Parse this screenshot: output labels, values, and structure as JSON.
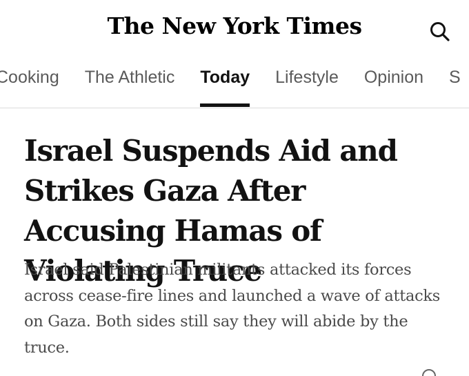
{
  "masthead": {
    "logo_text": "The New York Times",
    "search_icon": "search-icon"
  },
  "nav": {
    "items": [
      {
        "label": "Cooking"
      },
      {
        "label": "The Athletic"
      },
      {
        "label": "Today",
        "active": true
      },
      {
        "label": "Lifestyle"
      },
      {
        "label": "Opinion"
      },
      {
        "label": "S"
      }
    ]
  },
  "article": {
    "headline": "Israel Suspends Aid and Strikes Gaza After Accusing Hamas of Violating Truce",
    "summary": "Israel said Palestinian militants attacked its forces across cease-fire lines and launched a wave of attacks on Gaza. Both sides still say they will abide by the truce."
  },
  "colors": {
    "text": "#121212",
    "nav_inactive": "#5a5a5a",
    "summary": "#4a4a4a",
    "divider": "#dcdcdc"
  }
}
